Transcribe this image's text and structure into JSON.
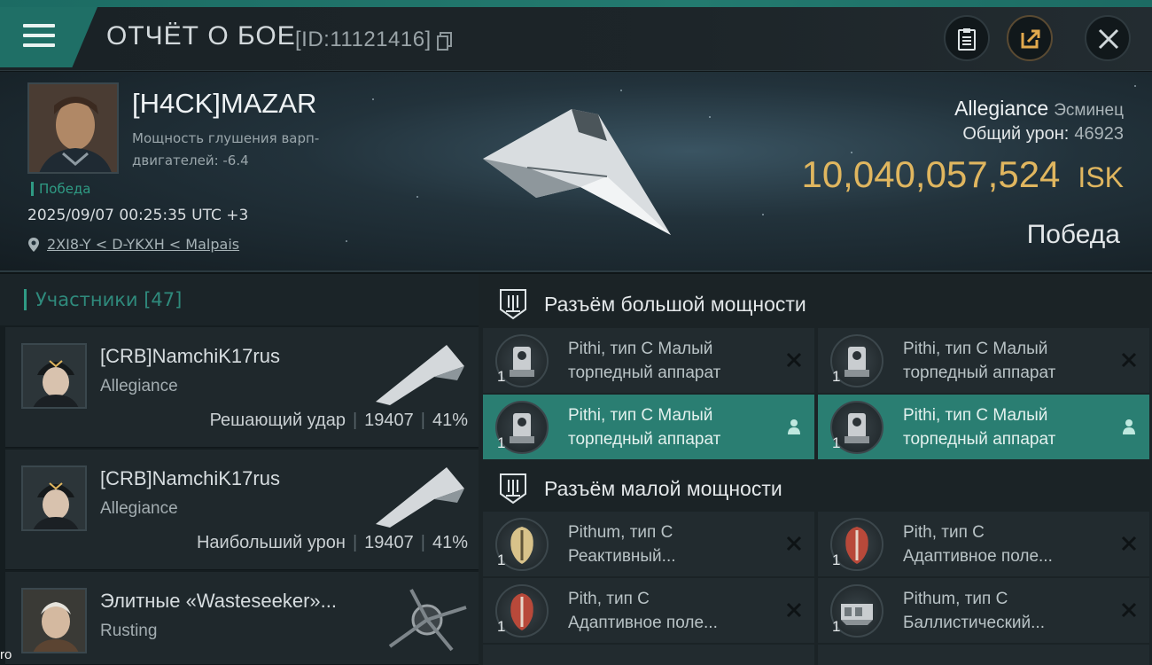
{
  "header": {
    "title": "ОТЧЁТ О БОЕ",
    "report_id": "[ID:11121416]"
  },
  "summary": {
    "pilot_name": "[H4CK]MAZAR",
    "warp_disruption_label": "Мощность глушения варп-двигателей: -6.4",
    "result_small": "Победа",
    "datetime": "2025/09/07 00:25:35 UTC +3",
    "location": "2XI8-Y < D-YKXH < Malpais",
    "ship_name": "Allegiance",
    "ship_class": "Эсминец",
    "total_damage_label": "Общий урон:",
    "total_damage_value": "46923",
    "isk_value": "10,040,057,524",
    "isk_currency": "ISK",
    "result_big": "Победа"
  },
  "participants": {
    "title": "Участники [47]",
    "items": [
      {
        "name": "[CRB]NamchiK17rus",
        "corp": "Allegiance",
        "role": "Решающий удар",
        "damage": "19407",
        "percent": "41%"
      },
      {
        "name": "[CRB]NamchiK17rus",
        "corp": "Allegiance",
        "role": "Наибольший урон",
        "damage": "19407",
        "percent": "41%"
      },
      {
        "name": "Элитные «Wasteseeker»...",
        "corp": "Rusting"
      }
    ]
  },
  "fitting": {
    "high_slots_title": "Разъём большой мощности",
    "low_slots_title": "Разъём малой мощности",
    "high_slots": [
      {
        "line1": "Pithi, тип C Малый",
        "line2": "торпедный аппарат",
        "qty": "1",
        "state": "destroyed"
      },
      {
        "line1": "Pithi, тип C Малый",
        "line2": "торпедный аппарат",
        "qty": "1",
        "state": "destroyed"
      },
      {
        "line1": "Pithi, тип C Малый",
        "line2": "торпедный аппарат",
        "qty": "1",
        "state": "dropped"
      },
      {
        "line1": "Pithi, тип C Малый",
        "line2": "торпедный аппарат",
        "qty": "1",
        "state": "dropped"
      }
    ],
    "low_slots": [
      {
        "line1": "Pithum, тип C",
        "line2": "Реактивный...",
        "qty": "1",
        "state": "destroyed"
      },
      {
        "line1": "Pith, тип C",
        "line2": "Адаптивное поле...",
        "qty": "1",
        "state": "destroyed"
      },
      {
        "line1": "Pith, тип C",
        "line2": "Адаптивное поле...",
        "qty": "1",
        "state": "destroyed"
      },
      {
        "line1": "Pithum, тип C",
        "line2": "Баллистический...",
        "qty": "1",
        "state": "destroyed"
      }
    ]
  },
  "overlay_text": "ro",
  "colors": {
    "accent": "#2a7e72",
    "isk": "#e0b65f",
    "victory": "#2f9b84"
  }
}
